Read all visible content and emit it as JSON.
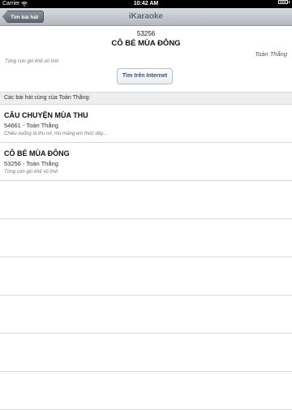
{
  "status_bar": {
    "carrier": "Carrier",
    "time": "10:42 AM",
    "wifi_icon": "wifi-icon",
    "battery_icon": "battery-icon"
  },
  "nav": {
    "back_label": "Tìm bài hát",
    "title": "iKaraoke"
  },
  "song": {
    "number": "53256",
    "title": "CÔ BÉ MÙA ĐÔNG",
    "artist": "Toàn Thắng",
    "lyric": "Từng cơn gió khẽ vô tình",
    "search_label": "Tìm trên Internet"
  },
  "section": {
    "header": "Các bài hát cùng của Toàn Thắng:"
  },
  "songs": [
    {
      "title": "CÂU CHUYỆN MÙA THU",
      "subtitle": "54661 - Toàn Thắng",
      "lyric": "Chiều xuống lá thu rơi, mơ màng em thức dậy..."
    },
    {
      "title": "CÔ BÉ MÙA ĐÔNG",
      "subtitle": "53256 - Toàn Thắng",
      "lyric": "Từng cơn gió khẽ vô tình"
    }
  ]
}
